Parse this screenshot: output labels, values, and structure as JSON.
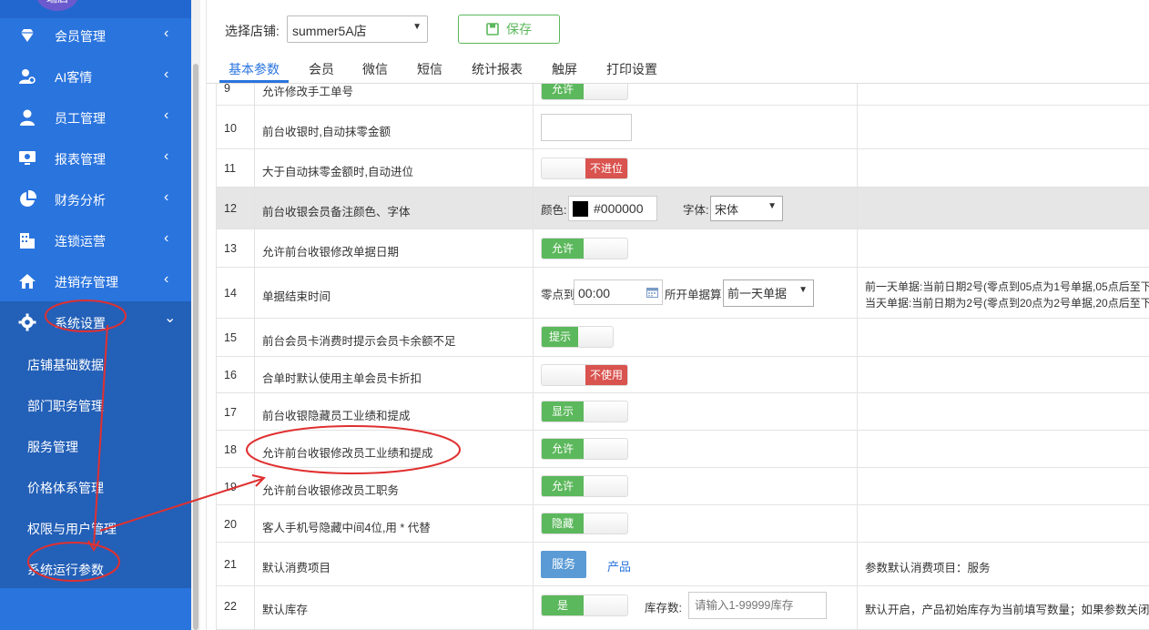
{
  "sidebar": {
    "avatar_text": "瑞启",
    "menu": [
      {
        "label": "会员管理",
        "chevron": "‹"
      },
      {
        "label": "AI客情",
        "chevron": "‹"
      },
      {
        "label": "员工管理",
        "chevron": "‹"
      },
      {
        "label": "报表管理",
        "chevron": "‹"
      },
      {
        "label": "财务分析",
        "chevron": "‹"
      },
      {
        "label": "连锁运营",
        "chevron": "‹"
      },
      {
        "label": "进销存管理",
        "chevron": "‹"
      },
      {
        "label": "系统设置",
        "chevron": "⌄"
      }
    ],
    "submenu": [
      {
        "label": "店铺基础数据"
      },
      {
        "label": "部门职务管理"
      },
      {
        "label": "服务管理"
      },
      {
        "label": "价格体系管理"
      },
      {
        "label": "权限与用户管理"
      },
      {
        "label": "系统运行参数"
      }
    ]
  },
  "toolbar": {
    "store_label": "选择店铺:",
    "store_value": "summer5A店",
    "save_label": "保存"
  },
  "tabs": [
    "基本参数",
    "会员",
    "微信",
    "短信",
    "统计报表",
    "触屏",
    "打印设置"
  ],
  "rows": {
    "r9": {
      "num": "9",
      "name": "允许修改手工单号",
      "toggle": "允许"
    },
    "r10": {
      "num": "10",
      "name": "前台收银时,自动抹零金额"
    },
    "r11": {
      "num": "11",
      "name": "大于自动抹零金额时,自动进位",
      "toggle": "不进位"
    },
    "r12": {
      "num": "12",
      "name": "前台收银会员备注颜色、字体",
      "color_label": "颜色:",
      "color_value": "#000000",
      "font_label": "字体:",
      "font_value": "宋体"
    },
    "r13": {
      "num": "13",
      "name": "允许前台收银修改单据日期",
      "toggle": "允许"
    },
    "r14": {
      "num": "14",
      "name": "单据结束时间",
      "zero_label": "零点到",
      "time_value": "00:00",
      "belong_label": "所开单据算",
      "belong_value": "前一天单据",
      "note1": "前一天单据:当前日期2号(零点到05点为1号单据,05点后至下",
      "note2": "当天单据:当前日期为2号(零点到20点为2号单据,20点后至下"
    },
    "r15": {
      "num": "15",
      "name": "前台会员卡消费时提示会员卡余额不足",
      "toggle": "提示"
    },
    "r16": {
      "num": "16",
      "name": "合单时默认使用主单会员卡折扣",
      "toggle": "不使用"
    },
    "r17": {
      "num": "17",
      "name": "前台收银隐藏员工业绩和提成",
      "toggle": "显示"
    },
    "r18": {
      "num": "18",
      "name": "允许前台收银修改员工业绩和提成",
      "toggle": "允许"
    },
    "r19": {
      "num": "19",
      "name": "允许前台收银修改员工职务",
      "toggle": "允许"
    },
    "r20": {
      "num": "20",
      "name": "客人手机号隐藏中间4位,用 * 代替",
      "toggle": "隐藏"
    },
    "r21": {
      "num": "21",
      "name": "默认消费项目",
      "btn": "服务",
      "link": "产品",
      "note": "参数默认消费项目：服务"
    },
    "r22": {
      "num": "22",
      "name": "默认库存",
      "toggle": "是",
      "stock_label": "库存数:",
      "stock_placeholder": "请输入1-99999库存",
      "note": "默认开启，产品初始库存为当前填写数量；如果参数关闭"
    }
  },
  "colors": {
    "sidebar": "#2a74de",
    "accent": "#2a74de",
    "toggle_on": "#5cb85c",
    "toggle_off": "#d9534f",
    "annotation": "#e03030"
  }
}
